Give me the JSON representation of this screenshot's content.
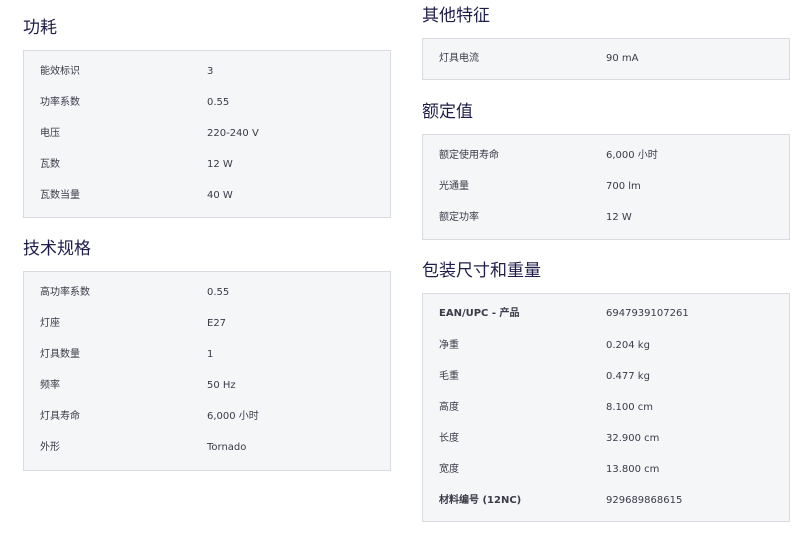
{
  "left": {
    "power": {
      "title": "功耗",
      "rows": [
        {
          "label": "能效标识",
          "value": "3"
        },
        {
          "label": "功率系数",
          "value": "0.55"
        },
        {
          "label": "电压",
          "value": "220-240 V"
        },
        {
          "label": "瓦数",
          "value": "12 W"
        },
        {
          "label": "瓦数当量",
          "value": "40 W"
        }
      ]
    },
    "tech": {
      "title": "技术规格",
      "rows": [
        {
          "label": "高功率系数",
          "value": "0.55"
        },
        {
          "label": "灯座",
          "value": "E27"
        },
        {
          "label": "灯具数量",
          "value": "1"
        },
        {
          "label": "频率",
          "value": "50 Hz"
        },
        {
          "label": "灯具寿命",
          "value": "6,000 小时"
        },
        {
          "label": "外形",
          "value": "Tornado"
        }
      ]
    }
  },
  "right": {
    "other": {
      "title": "其他特征",
      "rows": [
        {
          "label": "灯具电流",
          "value": "90 mA"
        }
      ]
    },
    "rated": {
      "title": "额定值",
      "rows": [
        {
          "label": "额定使用寿命",
          "value": "6,000 小时"
        },
        {
          "label": "光通量",
          "value": "700 lm"
        },
        {
          "label": "额定功率",
          "value": "12 W"
        }
      ]
    },
    "package": {
      "title": "包装尺寸和重量",
      "rows": [
        {
          "label": "EAN/UPC - 产品",
          "value": "6947939107261"
        },
        {
          "label": "净重",
          "value": "0.204 kg"
        },
        {
          "label": "毛重",
          "value": "0.477 kg"
        },
        {
          "label": "高度",
          "value": "8.100 cm"
        },
        {
          "label": "长度",
          "value": "32.900 cm"
        },
        {
          "label": "宽度",
          "value": "13.800 cm"
        },
        {
          "label": "材料编号 (12NC)",
          "value": "929689868615"
        }
      ]
    }
  }
}
